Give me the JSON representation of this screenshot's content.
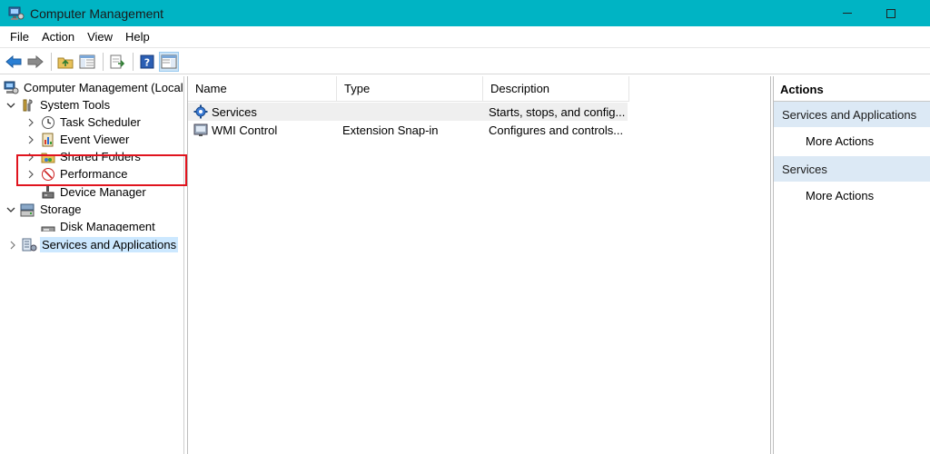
{
  "window": {
    "title": "Computer Management"
  },
  "menu": [
    "File",
    "Action",
    "View",
    "Help"
  ],
  "toolbar": {
    "icons": [
      "back-arrow-icon",
      "forward-arrow-icon",
      "up-folder-icon",
      "show-hide-tree-icon",
      "export-list-icon",
      "help-icon",
      "show-action-pane-icon"
    ]
  },
  "tree": {
    "root": "Computer Management (Local",
    "system_tools": "System Tools",
    "task_scheduler": "Task Scheduler",
    "event_viewer": "Event Viewer",
    "shared_folders": "Shared Folders",
    "performance": "Performance",
    "device_manager": "Device Manager",
    "storage": "Storage",
    "disk_management": "Disk Management",
    "services_apps": "Services and Applications"
  },
  "list": {
    "columns": [
      "Name",
      "Type",
      "Description"
    ],
    "rows": [
      {
        "name": "Services",
        "type": "",
        "description": "Starts, stops, and config..."
      },
      {
        "name": "WMI Control",
        "type": "Extension Snap-in",
        "description": "Configures and controls..."
      }
    ]
  },
  "actions": {
    "header": "Actions",
    "sections": [
      {
        "title": "Services and Applications",
        "items": [
          "More Actions"
        ]
      },
      {
        "title": "Services",
        "items": [
          "More Actions"
        ]
      }
    ]
  },
  "colors": {
    "titlebar": "#00b4c4",
    "selection": "#cce8ff",
    "highlight": "#e0141e",
    "action_section": "#dce9f5"
  }
}
